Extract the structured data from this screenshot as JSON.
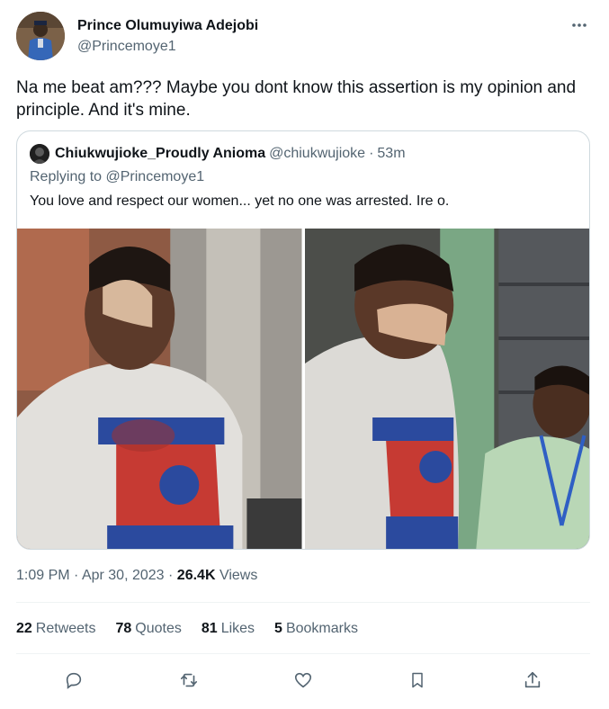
{
  "author": {
    "name": "Prince Olumuyiwa Adejobi",
    "handle": "@Princemoye1"
  },
  "more_icon": "more-horizontal-icon",
  "tweet": {
    "text": "Na me beat am??? Maybe you dont know this assertion  is my opinion and principle. And it's mine."
  },
  "quoted": {
    "name": "Chiukwujioke_Proudly Anioma",
    "handle": "@chiukwujioke",
    "separator": "·",
    "time": "53m",
    "replying_prefix": "Replying to",
    "replying_to": "@Princemoye1",
    "text": "You love and respect our women... yet no one was arrested. Ire o."
  },
  "meta": {
    "time": "1:09 PM",
    "sep1": "·",
    "date": "Apr 30, 2023",
    "sep2": "·",
    "views_count": "26.4K",
    "views_label": "Views"
  },
  "stats": [
    {
      "count": "22",
      "label": "Retweets"
    },
    {
      "count": "78",
      "label": "Quotes"
    },
    {
      "count": "81",
      "label": "Likes"
    },
    {
      "count": "5",
      "label": "Bookmarks"
    }
  ],
  "actions": [
    "reply-icon",
    "retweet-icon",
    "like-icon",
    "bookmark-icon",
    "share-icon"
  ],
  "colors": {
    "text": "#0f1419",
    "secondary": "#536471",
    "border": "#cfd9de",
    "divider": "#eff3f4"
  }
}
